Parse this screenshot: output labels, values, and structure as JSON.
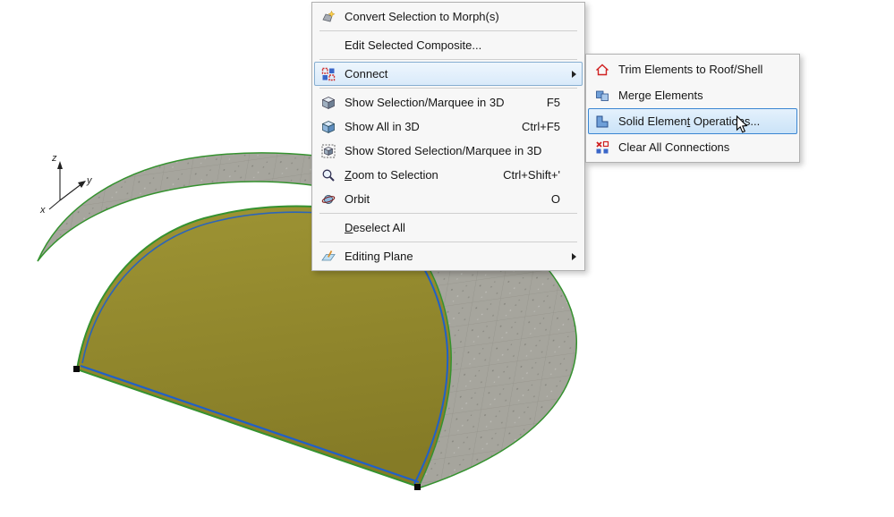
{
  "colors": {
    "roof_fill": "#9e9434",
    "roof_fill_dark": "#857b26",
    "slab_fill": "#a6a59d",
    "edge_green": "#35922f",
    "edge_blue": "#2060c8",
    "menu_highlight_border": "#86aed1",
    "submenu_highlight_border": "#3a86d2"
  },
  "axis": {
    "z": "z",
    "y": "y",
    "x": "x"
  },
  "menu": {
    "items": [
      {
        "label": "Convert Selection to Morph(s)",
        "shortcut": ""
      },
      {
        "label": "Edit Selected Composite...",
        "shortcut": ""
      },
      {
        "label": "Connect",
        "shortcut": "",
        "has_submenu": true,
        "highlighted": true
      },
      {
        "label": "Show Selection/Marquee in 3D",
        "shortcut": "F5"
      },
      {
        "label": "Show All in 3D",
        "shortcut": "Ctrl+F5"
      },
      {
        "label": "Show Stored Selection/Marquee in 3D",
        "shortcut": ""
      },
      {
        "label": "Zoom to Selection",
        "shortcut": "Ctrl+Shift+'"
      },
      {
        "label": "Orbit",
        "shortcut": "O"
      },
      {
        "label": "Deselect All",
        "shortcut": ""
      },
      {
        "label": "Editing Plane",
        "shortcut": "",
        "has_submenu": true
      }
    ]
  },
  "submenu": {
    "items": [
      {
        "label": "Trim Elements to Roof/Shell"
      },
      {
        "label": "Merge Elements"
      },
      {
        "label": "Solid Element Operations...",
        "highlighted": true
      },
      {
        "label": "Clear All Connections"
      }
    ]
  }
}
